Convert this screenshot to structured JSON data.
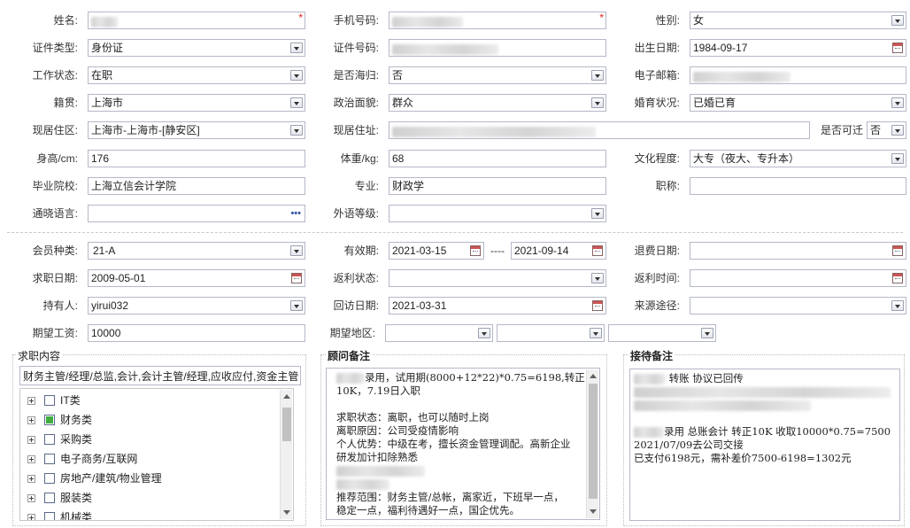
{
  "personal": {
    "name_label": "姓名:",
    "phone_label": "手机号码:",
    "gender_label": "性别:",
    "gender_value": "女",
    "id_type_label": "证件类型:",
    "id_type_value": "身份证",
    "id_number_label": "证件号码:",
    "birth_label": "出生日期:",
    "birth_value": "1984-09-17",
    "work_status_label": "工作状态:",
    "work_status_value": "在职",
    "returnee_label": "是否海归:",
    "returnee_value": "否",
    "email_label": "电子邮箱:",
    "native_label": "籍贯:",
    "native_value": "上海市",
    "political_label": "政治面貌:",
    "political_value": "群众",
    "marital_label": "婚育状况:",
    "marital_value": "已婚已育",
    "residence_area_label": "现居住区:",
    "residence_area_value": "上海市-上海市-[静安区]",
    "address_label": "现居住址:",
    "relocate_label": "是否可迁",
    "relocate_value": "否",
    "height_label": "身高/cm:",
    "height_value": "176",
    "weight_label": "体重/kg:",
    "weight_value": "68",
    "education_label": "文化程度:",
    "education_value": "大专（夜大、专升本）",
    "school_label": "毕业院校:",
    "school_value": "上海立信会计学院",
    "major_label": "专业:",
    "major_value": "财政学",
    "title_label": "职称:",
    "language_label": "通晓语言:",
    "fl_level_label": "外语等级:"
  },
  "membership": {
    "member_type_label": "会员种类:",
    "member_type_value": "21-A",
    "valid_label": "有效期:",
    "valid_from": "2021-03-15",
    "valid_sep": "----",
    "valid_to": "2021-09-14",
    "refund_date_label": "退费日期:",
    "job_date_label": "求职日期:",
    "job_date_value": "2009-05-01",
    "rebate_status_label": "返利状态:",
    "rebate_time_label": "返利时间:",
    "holder_label": "持有人:",
    "holder_value": "yirui032",
    "visit_date_label": "回访日期:",
    "visit_date_value": "2021-03-31",
    "source_label": "来源途径:",
    "salary_label": "期望工资:",
    "salary_value": "10000",
    "region_label": "期望地区:"
  },
  "job_panel": {
    "title": "求职内容",
    "summary": "财务主管/经理/总监,会计,会计主管/经理,应收应付,资金主管",
    "categories": [
      {
        "label": "IT类",
        "checked": false
      },
      {
        "label": "财务类",
        "checked": true
      },
      {
        "label": "采购类",
        "checked": false
      },
      {
        "label": "电子商务/互联网",
        "checked": false
      },
      {
        "label": "房地产/建筑/物业管理",
        "checked": false
      },
      {
        "label": "服装类",
        "checked": false
      },
      {
        "label": "机械类",
        "checked": false
      }
    ]
  },
  "consultant_panel": {
    "title": "顾问备注",
    "line1": "录用，试用期(8000+12*22)*0.75=6198,转正",
    "line2": "10K，7.19日入职",
    "line3": "",
    "line4": "求职状态：离职，也可以随时上岗",
    "line5": "离职原因：公司受疫情影响",
    "line6": "个人优势：中级在考，擅长资金管理调配。高新企业",
    "line7": "研发加计扣除熟悉",
    "line8": "",
    "line9": "",
    "line10": "推荐范围：财务主管/总帐，离家近，下班早一点，",
    "line11": "稳定一点，福利待遇好一点，国企优先。"
  },
  "reception_panel": {
    "title": "接待备注",
    "line1_suffix": "转账 协议已回传",
    "line4": "录用 总账会计 转正10K 收取10000*0.75=7500",
    "line5": "2021/07/09去公司交接",
    "line6": "已支付6198元，需补差价7500-6198=1302元"
  }
}
